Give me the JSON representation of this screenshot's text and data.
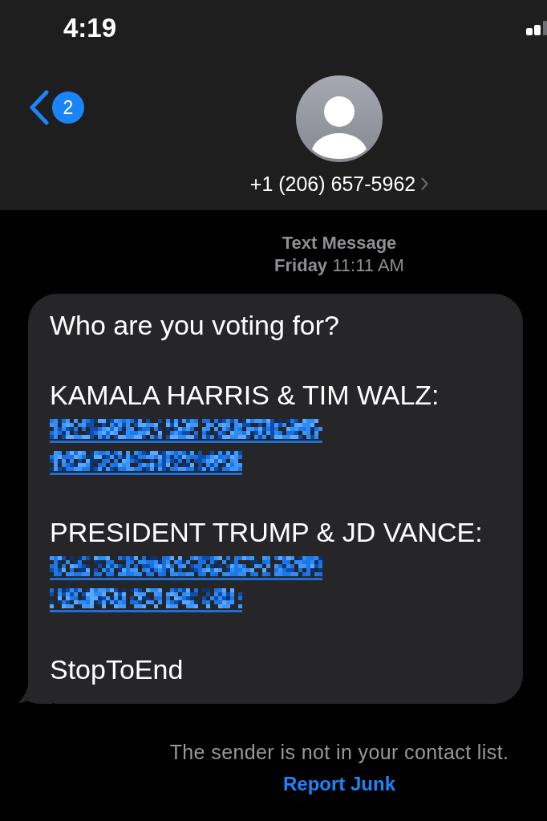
{
  "status_bar": {
    "time": "4:19"
  },
  "header": {
    "back_badge": "2",
    "contact": "+1 (206) 657-5962"
  },
  "thread": {
    "service": "Text Message",
    "timestamp": "**Friday** 11:11 AM"
  },
  "message": {
    "paragraphs": [
      {
        "parts": [
          {
            "kind": "text",
            "text": "Who are you voting for?"
          }
        ]
      },
      {
        "parts": [
          {
            "kind": "text",
            "text": "KAMALA HARRIS & TIM WALZ:"
          },
          {
            "kind": "redacted_link"
          }
        ]
      },
      {
        "parts": [
          {
            "kind": "text",
            "text": "PRESIDENT TRUMP & JD VANCE:"
          },
          {
            "kind": "redacted_link"
          }
        ]
      },
      {
        "parts": [
          {
            "kind": "text",
            "text": "StopToEnd"
          }
        ]
      }
    ]
  },
  "footer": {
    "notice": "The sender is not in your contact list.",
    "action": "Report Junk"
  }
}
